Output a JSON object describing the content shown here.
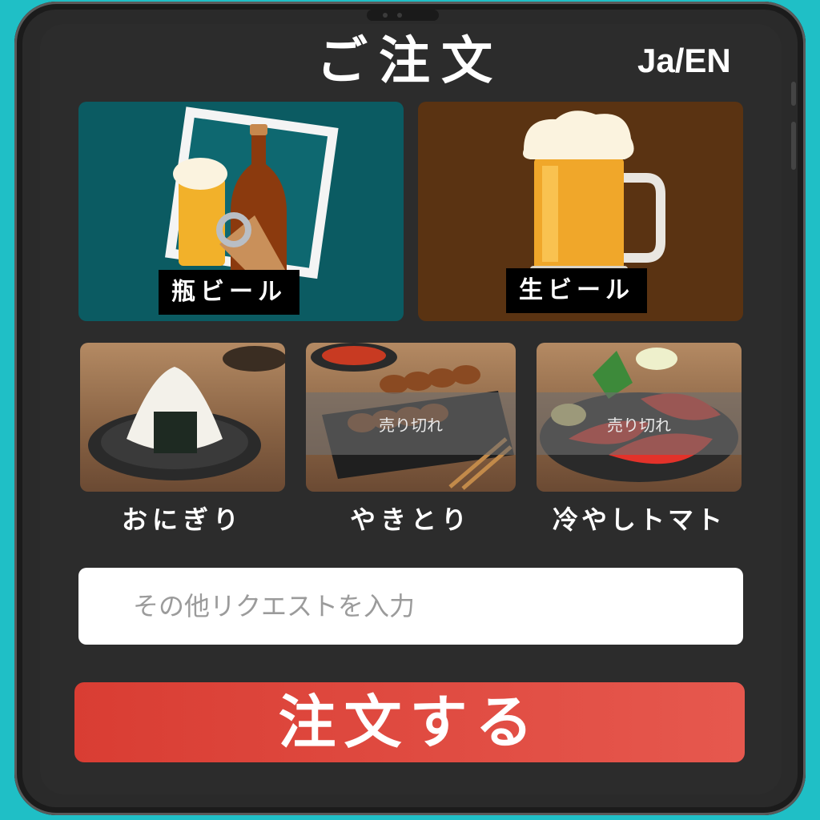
{
  "header": {
    "title": "ご注文",
    "lang_toggle": "Ja/EN"
  },
  "drinks": [
    {
      "label": "瓶ビール",
      "icon": "bottle-beer-icon"
    },
    {
      "label": "生ビール",
      "icon": "beer-mug-icon"
    }
  ],
  "foods": [
    {
      "label": "おにぎり",
      "icon": "onigiri-icon",
      "status": ""
    },
    {
      "label": "やきとり",
      "icon": "yakitori-icon",
      "status": "売り切れ"
    },
    {
      "label": "冷やしトマト",
      "icon": "tomato-icon",
      "status": "売り切れ"
    }
  ],
  "request": {
    "placeholder": "その他リクエストを入力"
  },
  "order_button": {
    "label": "注文する"
  },
  "colors": {
    "background": "#1fbfc6",
    "order_button": "#e04a40",
    "drink_card_1": "#0b5b62",
    "drink_card_2": "#5a3312"
  }
}
